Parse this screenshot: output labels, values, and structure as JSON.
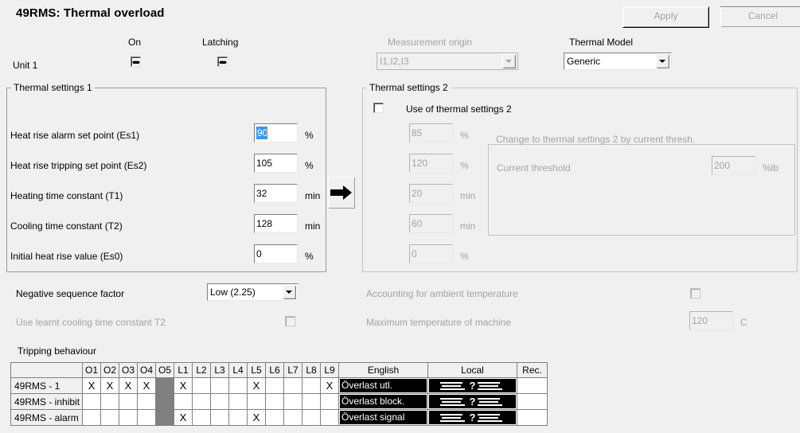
{
  "window": {
    "title": "49RMS: Thermal overload"
  },
  "toolbar": {
    "apply_label": "Apply",
    "cancel_label": "Cancel"
  },
  "unit_row": {
    "on_header": "On",
    "latching_header": "Latching",
    "unit_label": "Unit 1",
    "on_checked": true,
    "latching_checked": true
  },
  "measurement_origin": {
    "label": "Measurement origin",
    "value": "I1,I2,I3",
    "enabled": false
  },
  "thermal_model": {
    "label": "Thermal Model",
    "value": "Generic",
    "enabled": true
  },
  "thermal_settings_1": {
    "title": "Thermal settings 1",
    "rows": [
      {
        "label": "Heat rise alarm set point (Es1)",
        "value": "90",
        "unit": "%",
        "selected": true
      },
      {
        "label": "Heat rise tripping set point (Es2)",
        "value": "105",
        "unit": "%",
        "selected": false
      },
      {
        "label": "Heating time constant (T1)",
        "value": "32",
        "unit": "min",
        "selected": false
      },
      {
        "label": "Cooling time constant (T2)",
        "value": "128",
        "unit": "min",
        "selected": false
      },
      {
        "label": "Initial heat rise value (Es0)",
        "value": "0",
        "unit": "%",
        "selected": false
      }
    ]
  },
  "copy_button": {
    "icon": "arrow-right-icon"
  },
  "thermal_settings_2": {
    "title": "Thermal settings 2",
    "use_label": "Use of thermal settings 2",
    "use_checked": false,
    "rows": [
      {
        "value": "85",
        "unit": "%"
      },
      {
        "value": "120",
        "unit": "%"
      },
      {
        "value": "20",
        "unit": "min"
      },
      {
        "value": "60",
        "unit": "min"
      },
      {
        "value": "0",
        "unit": "%"
      }
    ],
    "change_group": {
      "title": "Change to thermal settings 2 by current thresh.",
      "current_threshold_label": "Current threshold",
      "current_threshold_value": "200",
      "current_threshold_unit": "%lb"
    }
  },
  "options": {
    "negative_sequence_label": "Negative sequence factor",
    "negative_sequence_value": "Low (2.25)",
    "learnt_cooling_label": "Use learnt cooling time constant T2",
    "learnt_cooling_checked": false,
    "ambient_label": "Accounting for ambient temperature",
    "ambient_checked": false,
    "max_temp_label": "Maximum temperature of machine",
    "max_temp_value": "120",
    "max_temp_unit": "C"
  },
  "tripping": {
    "title": "Tripping behaviour",
    "columns": [
      "O1",
      "O2",
      "O3",
      "O4",
      "O5",
      "L1",
      "L2",
      "L3",
      "L4",
      "L5",
      "L6",
      "L7",
      "L8",
      "L9"
    ],
    "english_header": "English",
    "local_header": "Local",
    "rec_header": "Rec.",
    "rows": [
      {
        "name": "49RMS - 1",
        "marks": [
          "X",
          "X",
          "X",
          "X",
          "",
          "X",
          "",
          "",
          "",
          "X",
          "",
          "",
          "",
          "X"
        ],
        "greyed": [
          false,
          false,
          false,
          false,
          true,
          false,
          false,
          false,
          false,
          false,
          false,
          false,
          false,
          false
        ],
        "english": "Överlast utl.",
        "local": "?",
        "rec": ""
      },
      {
        "name": "49RMS - inhibit",
        "marks": [
          "",
          "",
          "",
          "",
          "",
          "",
          "",
          "",
          "",
          "",
          "",
          "",
          "",
          ""
        ],
        "greyed": [
          false,
          false,
          false,
          false,
          true,
          false,
          false,
          false,
          false,
          false,
          false,
          false,
          false,
          false
        ],
        "english": "Överlast block.",
        "local": "?",
        "rec": ""
      },
      {
        "name": "49RMS - alarm",
        "marks": [
          "",
          "",
          "",
          "",
          "",
          "X",
          "",
          "",
          "",
          "X",
          "",
          "",
          "",
          ""
        ],
        "greyed": [
          false,
          false,
          false,
          false,
          true,
          false,
          false,
          false,
          false,
          false,
          false,
          false,
          false,
          false
        ],
        "english": "Överlast signal",
        "local": "?",
        "rec": ""
      }
    ]
  },
  "colors": {
    "background": "#f0f0f0",
    "selection": "#3399ff",
    "disabled_text": "#a3a3a3",
    "border": "#808080",
    "greyed_cell": "#808080"
  }
}
